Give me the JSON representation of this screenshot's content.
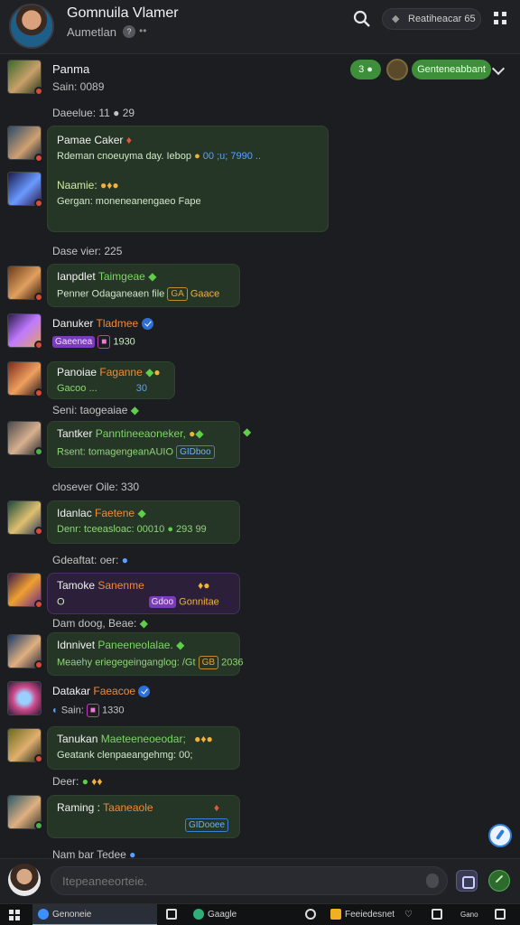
{
  "header": {
    "title": "Gomnuila Vlamer",
    "subtitle": "Aumetlan",
    "subtitle_dot": "?",
    "subtitle_extra": "••",
    "recording_label": "Reatiheacar",
    "recording_suffix": "65"
  },
  "top_member": {
    "name": "Panma",
    "status": "Sain: 0089",
    "pill_small": "3 ●",
    "pill_large": "Genteneabbant"
  },
  "messages": [
    {
      "type": "divider",
      "text": "Daeelue: 11 ● 29"
    },
    {
      "type": "bubble_pair",
      "name1": "Pamae Caker",
      "text1": "Rdeman cnoeuyma day. Iebop",
      "text1_tail": "00 ;u; 7990 ..",
      "name2": "Naamie:",
      "text2": "Gergan: moneneanengaeo Fape"
    },
    {
      "type": "divider",
      "text": "Dase vier: 225"
    },
    {
      "type": "bubble",
      "name": "Ianpdlet",
      "accent": "Taimgeae",
      "text": "Penner Odaganeaen file",
      "tag": "GA",
      "tail": "Gaace"
    },
    {
      "type": "plain",
      "name": "Danuker",
      "accent": "Tladmee",
      "tag": "Gaeenea",
      "tail": "1930"
    },
    {
      "type": "bubble",
      "name": "Panoiae",
      "accent": "Faganne",
      "text": "Gacoo ...",
      "tail": "30"
    },
    {
      "type": "divider",
      "text": "Seni: taogeaiae"
    },
    {
      "type": "bubble",
      "name": "Tantker",
      "accent": "Panntineeaoneker,",
      "text": "Rsent: tomagengeanAUIO",
      "tag": "GIDboo"
    },
    {
      "type": "divider",
      "text": "closever Oile: 330"
    },
    {
      "type": "bubble",
      "name": "Idanlac",
      "accent": "Faetene",
      "text": "Denr: tceeasloac: 00010",
      "tail": "293 99"
    },
    {
      "type": "divider",
      "text": "Gdeaftat: oer:"
    },
    {
      "type": "bubble",
      "name": "Tamoke",
      "accent": "Sanenme",
      "text": "O",
      "tag": "Gdoo",
      "tail": "Gonnitae"
    },
    {
      "type": "divider",
      "text": "Dam doog, Beae:"
    },
    {
      "type": "bubble",
      "name": "Idnnivet",
      "accent": "Paneeneolalae.",
      "text": "Meaehy eriegegeinganglog: /Gt",
      "tag": "GB",
      "tail": "2036"
    },
    {
      "type": "plain",
      "name": "Datakar",
      "accent": "Faeacoe",
      "text": "Sain:",
      "tail": "1330"
    },
    {
      "type": "bubble",
      "name": "Tanukan",
      "accent": "Maeteeneoeodar;",
      "text": "Geatank clenpaeangehmg: 00;"
    },
    {
      "type": "divider",
      "text": "Deer:"
    },
    {
      "type": "bubble",
      "name": "Raming :",
      "accent": "Taaneaole",
      "text": "",
      "tag": "GIDooee"
    },
    {
      "type": "divider",
      "text": "Nam bar Tedee"
    }
  ],
  "composer": {
    "placeholder": "Itepeaneeorteie."
  },
  "taskbar": {
    "search_label": "Genoneie",
    "app1_label": "Gaagle",
    "app2_label": "Feeiedesnet",
    "tray_label": "Gano"
  },
  "colors": {
    "accent_green": "#3d8f3a",
    "bubble_green": "#263626",
    "bubble_purple": "#2b1f3a",
    "name_orange": "#f08a3a"
  },
  "icons": [
    "search-icon",
    "recording-icon",
    "grid-icon",
    "chevron-down-icon",
    "verified-icon",
    "compass-icon",
    "mic-icon",
    "attach-icon",
    "send-icon",
    "windows-icon"
  ]
}
